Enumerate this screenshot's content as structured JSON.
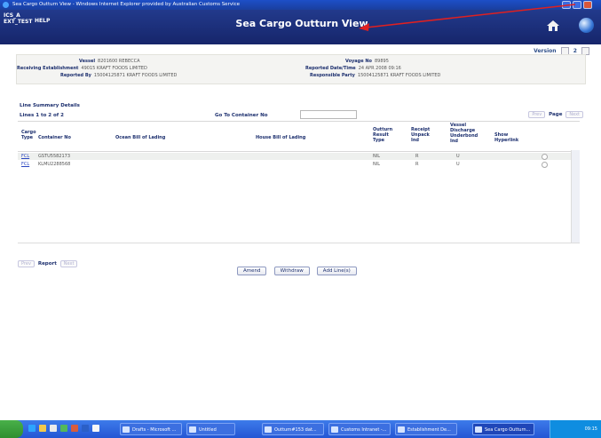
{
  "browser": {
    "title": "Sea Cargo Outturn View - Windows Internet Explorer provided by Australian Customs Service"
  },
  "app": {
    "system": "ICS_A",
    "env": "EXT_TEST",
    "help": "HELP",
    "page_title": "Sea Cargo Outturn View",
    "colors": {
      "header": "#1c2f6e",
      "annotation_arrow": "#e02020",
      "link": "#2844c0"
    },
    "icons": [
      "home-icon",
      "globe-icon"
    ]
  },
  "version": {
    "label": "Version",
    "value": "2"
  },
  "header": {
    "vessel_label": "Vessel",
    "vessel": "8201600 REBECCA",
    "receiving_label": "Receiving Establishment",
    "receiving": "49015 KRAFT FOODS LIMITED",
    "reported_by_label": "Reported By",
    "reported_by": "15004125871 KRAFT FOODS LIMITED",
    "voyage_label": "Voyage No",
    "voyage": "89895",
    "reported_dt_label": "Reported Date/Time",
    "reported_dt": "24 APR 2008 09:16",
    "responsible_label": "Responsible Party",
    "responsible": "15004125871 KRAFT FOODS LIMITED"
  },
  "summary": {
    "section": "Line Summary Details",
    "lines": "Lines 1 to 2 of 2",
    "goto_label": "Go To Container No",
    "goto_value": "",
    "prev": "Prev",
    "page": "Page",
    "next": "Next"
  },
  "table": {
    "columns": {
      "cargo_type_1": "Cargo",
      "cargo_type_2": "Type",
      "container": "Container No",
      "ocean": "Ocean Bill of Lading",
      "house": "House Bill of Lading",
      "outturn_1": "Outturn",
      "outturn_2": "Result",
      "outturn_3": "Type",
      "receipt_1": "Receipt",
      "receipt_2": "Unpack",
      "receipt_3": "Ind",
      "vessel_1": "Vessel",
      "vessel_2": "Discharge",
      "vessel_3": "Underbond",
      "vessel_4": "Ind",
      "show_1": "Show",
      "show_2": "Hyperlink"
    },
    "rows": [
      {
        "type": "FCL",
        "container": "GSTU5582173",
        "ocean": "",
        "house": "",
        "outturn": "NIL",
        "receipt": "R",
        "vessel": "U"
      },
      {
        "type": "FCL",
        "container": "KLMU2288568",
        "ocean": "",
        "house": "",
        "outturn": "NIL",
        "receipt": "R",
        "vessel": "U"
      }
    ]
  },
  "bottom": {
    "prev": "Prev",
    "report": "Report",
    "next": "Next",
    "amend": "Amend",
    "withdraw": "Withdraw",
    "add_lines": "Add Line(s)"
  },
  "taskbar": {
    "tasks": [
      "Drafts - Microsoft ...",
      "Untitled",
      "Outturn#153 dat...",
      "Customs Intranet -...",
      "Establishment De...",
      "Sea Cargo Outturn..."
    ],
    "time": "09:15"
  }
}
